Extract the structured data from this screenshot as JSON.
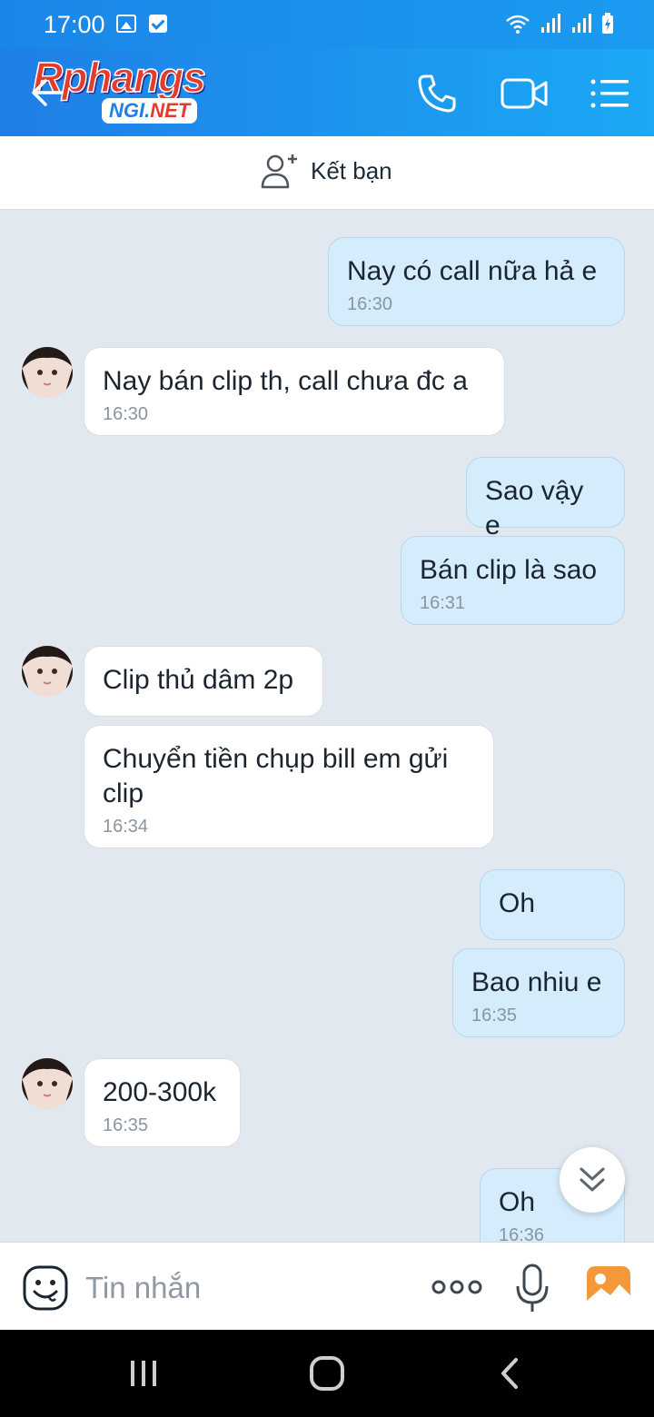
{
  "status_bar": {
    "time": "17:00"
  },
  "header": {
    "logo_main": "Rphangs",
    "logo_sub_left": "NGI.",
    "logo_sub_right": "NET"
  },
  "friend_bar": {
    "label": "Kết bạn"
  },
  "messages": [
    {
      "sender": "me",
      "text": "Nay có call nữa hả e",
      "time": "16:30"
    },
    {
      "sender": "them",
      "text": "Nay bán clip th, call chưa đc a",
      "time": "16:30"
    },
    {
      "sender": "me",
      "text": "Sao vậy e",
      "time": ""
    },
    {
      "sender": "me",
      "text": "Bán clip là sao",
      "time": "16:31"
    },
    {
      "sender": "them",
      "text": "Clip thủ dâm 2p",
      "time": ""
    },
    {
      "sender": "them",
      "text": "Chuyển tiền chụp bill em gửi clip",
      "time": "16:34"
    },
    {
      "sender": "me",
      "text": "Oh",
      "time": ""
    },
    {
      "sender": "me",
      "text": "Bao nhiu e",
      "time": "16:35"
    },
    {
      "sender": "them",
      "text": "200-300k",
      "time": "16:35"
    },
    {
      "sender": "me",
      "text": "Oh",
      "time": "16:36"
    }
  ],
  "input_bar": {
    "placeholder": "Tin nhắn"
  },
  "colors": {
    "header_blue": "#1f7fe6",
    "my_bubble": "#d4ecfc",
    "their_bubble": "#ffffff",
    "chat_background": "#e2e8ef",
    "image_icon_orange": "#f5983a"
  },
  "icons": {
    "header": [
      "back-arrow-icon",
      "phone-icon",
      "video-call-icon",
      "menu-list-icon"
    ],
    "input": [
      "emoji-icon",
      "more-dots-icon",
      "microphone-icon",
      "image-icon"
    ],
    "nav": [
      "recent-apps-icon",
      "home-icon",
      "back-icon"
    ]
  }
}
